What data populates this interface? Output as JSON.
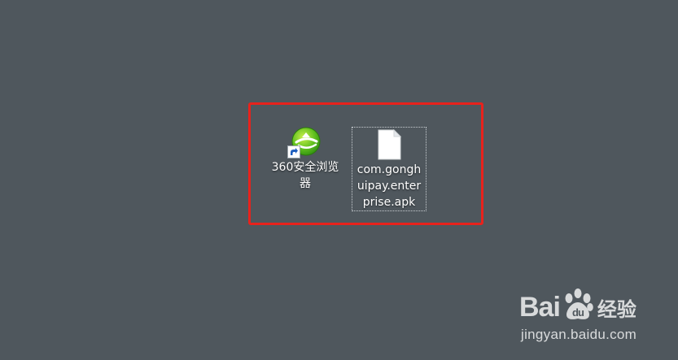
{
  "desktop": {
    "background_color": "#4f575d",
    "highlight_color": "#e8221c",
    "icons": [
      {
        "label": "360安全浏览器",
        "icon": "360-browser-icon",
        "shortcut": true
      },
      {
        "label": "com.gonghuipay.enterprise.apk",
        "icon": "blank-file-icon",
        "selected": true
      }
    ]
  },
  "watermark": {
    "logo_left": "Bai",
    "logo_right": "经验",
    "url": "jingyan.baidu.com"
  }
}
